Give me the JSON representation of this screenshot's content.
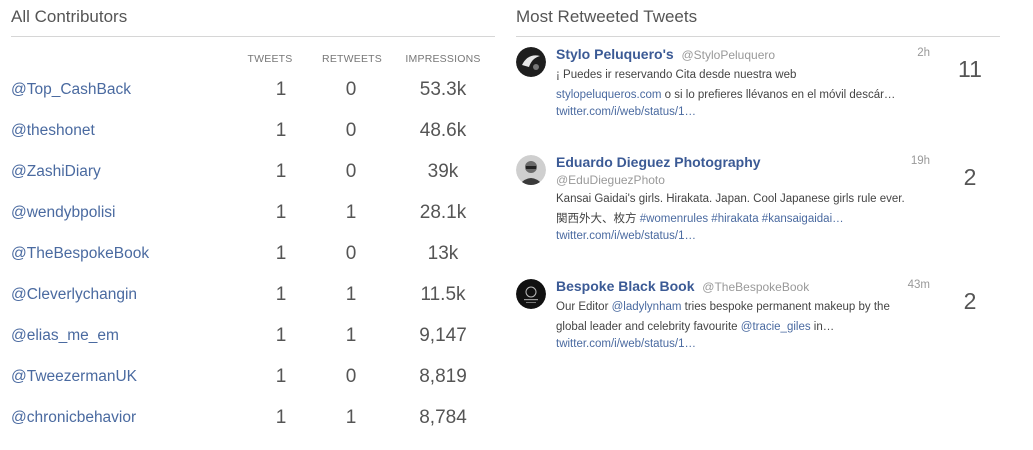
{
  "contributors": {
    "title": "All Contributors",
    "columns": [
      "TWEETS",
      "RETWEETS",
      "IMPRESSIONS"
    ],
    "rows": [
      {
        "handle": "@Top_CashBack",
        "tweets": "1",
        "retweets": "0",
        "impressions": "53.3k"
      },
      {
        "handle": "@theshonet",
        "tweets": "1",
        "retweets": "0",
        "impressions": "48.6k"
      },
      {
        "handle": "@ZashiDiary",
        "tweets": "1",
        "retweets": "0",
        "impressions": "39k"
      },
      {
        "handle": "@wendybpolisi",
        "tweets": "1",
        "retweets": "1",
        "impressions": "28.1k"
      },
      {
        "handle": "@TheBespokeBook",
        "tweets": "1",
        "retweets": "0",
        "impressions": "13k"
      },
      {
        "handle": "@Cleverlychangin",
        "tweets": "1",
        "retweets": "1",
        "impressions": "11.5k"
      },
      {
        "handle": "@elias_me_em",
        "tweets": "1",
        "retweets": "1",
        "impressions": "9,147"
      },
      {
        "handle": "@TweezermanUK",
        "tweets": "1",
        "retweets": "0",
        "impressions": "8,819"
      },
      {
        "handle": "@chronicbehavior",
        "tweets": "1",
        "retweets": "1",
        "impressions": "8,784"
      }
    ]
  },
  "retweeted": {
    "title": "Most Retweeted Tweets",
    "tweets": [
      {
        "name": "Stylo Peluquero's",
        "handle": "@StyloPeluquero",
        "time": "2h",
        "line1": "¡ Puedes ir reservando Cita desde nuestra web",
        "line2_link": "stylopeluqueros.com",
        "line2_rest": " o si lo prefieres llévanos en el móvil descár…",
        "url": "twitter.com/i/web/status/1…",
        "count": "11"
      },
      {
        "name": "Eduardo Dieguez Photography",
        "handle": "@EduDieguezPhoto",
        "time": "19h",
        "line1": "Kansai Gaidai's girls. Hirakata. Japan. Cool Japanese girls rule ever.",
        "line2_plain": "関西外大、枚方 ",
        "line2_link": "#womenrules #hirakata #kansaigaidai…",
        "url": "twitter.com/i/web/status/1…",
        "count": "2"
      },
      {
        "name": "Bespoke Black Book",
        "handle": "@TheBespokeBook",
        "time": "43m",
        "line1_plain": "Our Editor ",
        "line1_link": "@ladylynham",
        "line1_rest": " tries bespoke permanent makeup by the",
        "line2_plain": "global leader and celebrity favourite ",
        "line2_link": "@tracie_giles",
        "line2_rest": " in…",
        "url": "twitter.com/i/web/status/1…",
        "count": "2"
      }
    ]
  }
}
